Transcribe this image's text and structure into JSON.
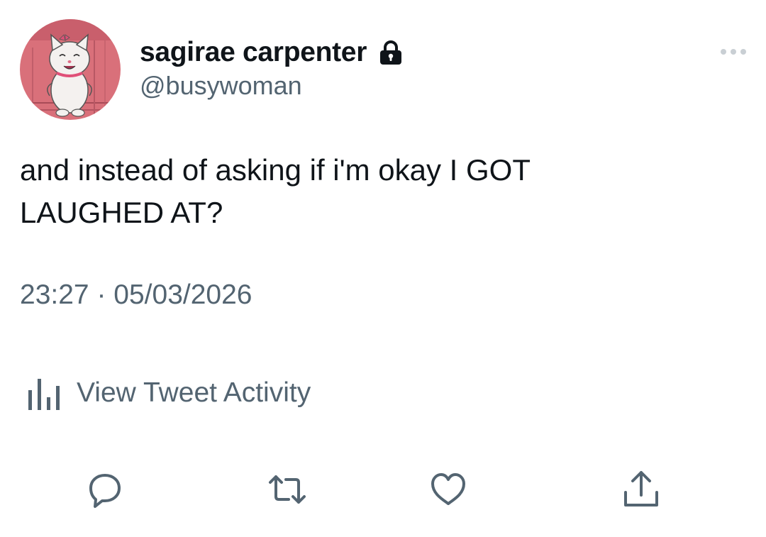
{
  "author": {
    "display_name": "sagirae carpenter",
    "handle": "@busywoman",
    "protected_icon": "lock-icon",
    "avatar_icon": "cartoon-cat-avatar"
  },
  "tweet": {
    "text": "and instead of asking if i'm okay I GOT\nLAUGHED AT?",
    "time": "23:27",
    "separator": "·",
    "date": "05/03/2026"
  },
  "activity": {
    "label": "View Tweet Activity",
    "icon": "bar-chart-icon"
  },
  "actions": {
    "reply_icon": "reply-icon",
    "retweet_icon": "retweet-icon",
    "like_icon": "like-icon",
    "share_icon": "share-icon",
    "more_icon": "more-icon"
  },
  "colors": {
    "text_primary": "#0f1419",
    "text_secondary": "#536471",
    "avatar_bg": "#d9707a"
  }
}
